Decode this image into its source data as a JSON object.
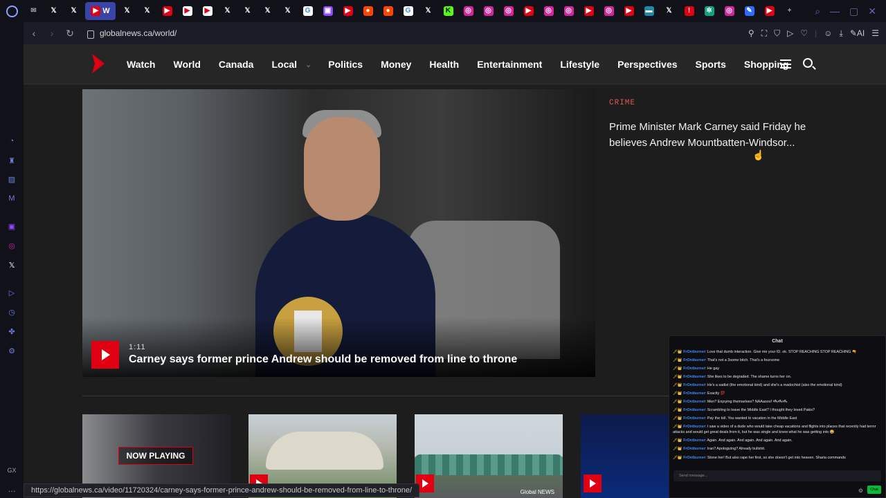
{
  "browser": {
    "tabs": [
      {
        "name": "tab-mail-icon",
        "glyph": "✉",
        "color": "#9aa0b4",
        "bg": "transparent"
      },
      {
        "name": "tab-x-icon",
        "glyph": "𝕏",
        "color": "#ffffff",
        "bg": "transparent"
      },
      {
        "name": "tab-x-icon",
        "glyph": "𝕏",
        "color": "#ffffff",
        "bg": "transparent"
      },
      {
        "name": "tab-active-world",
        "glyph": "▶",
        "color": "#ffffff",
        "bg": "#e10012"
      },
      {
        "name": "tab-x-icon",
        "glyph": "𝕏",
        "color": "#ffffff",
        "bg": "transparent"
      },
      {
        "name": "tab-x-icon",
        "glyph": "𝕏",
        "color": "#ffffff",
        "bg": "transparent"
      },
      {
        "name": "tab-youtube-icon",
        "glyph": "▶",
        "color": "#ffffff",
        "bg": "#e10012"
      },
      {
        "name": "tab-globalnews-icon",
        "glyph": "▶",
        "color": "#e10012",
        "bg": "#ffffff"
      },
      {
        "name": "tab-globalnews-icon",
        "glyph": "▶",
        "color": "#e10012",
        "bg": "#ffffff"
      },
      {
        "name": "tab-x-icon",
        "glyph": "𝕏",
        "color": "#ffffff",
        "bg": "transparent"
      },
      {
        "name": "tab-x-icon",
        "glyph": "𝕏",
        "color": "#ffffff",
        "bg": "transparent"
      },
      {
        "name": "tab-x-icon",
        "glyph": "𝕏",
        "color": "#ffffff",
        "bg": "transparent"
      },
      {
        "name": "tab-x-icon",
        "glyph": "𝕏",
        "color": "#ffffff",
        "bg": "transparent"
      },
      {
        "name": "tab-google-icon",
        "glyph": "G",
        "color": "#4285f4",
        "bg": "#ffffff"
      },
      {
        "name": "tab-twitch-icon",
        "glyph": "▣",
        "color": "#ffffff",
        "bg": "#9146ff"
      },
      {
        "name": "tab-youtube-icon",
        "glyph": "▶",
        "color": "#ffffff",
        "bg": "#e10012"
      },
      {
        "name": "tab-reddit-icon",
        "glyph": "●",
        "color": "#ffffff",
        "bg": "#ff4500"
      },
      {
        "name": "tab-reddit-icon",
        "glyph": "●",
        "color": "#ffffff",
        "bg": "#ff4500"
      },
      {
        "name": "tab-google-icon",
        "glyph": "G",
        "color": "#4285f4",
        "bg": "#ffffff"
      },
      {
        "name": "tab-x-icon",
        "glyph": "𝕏",
        "color": "#ffffff",
        "bg": "transparent"
      },
      {
        "name": "tab-kick-icon",
        "glyph": "K",
        "color": "#000000",
        "bg": "#53fc18"
      },
      {
        "name": "tab-instagram-icon",
        "glyph": "◎",
        "color": "#ffffff",
        "bg": "#d6249f"
      },
      {
        "name": "tab-instagram-icon",
        "glyph": "◎",
        "color": "#ffffff",
        "bg": "#d6249f"
      },
      {
        "name": "tab-instagram-icon",
        "glyph": "◎",
        "color": "#ffffff",
        "bg": "#d6249f"
      },
      {
        "name": "tab-youtube-icon",
        "glyph": "▶",
        "color": "#ffffff",
        "bg": "#e10012"
      },
      {
        "name": "tab-instagram-icon",
        "glyph": "◎",
        "color": "#ffffff",
        "bg": "#d6249f"
      },
      {
        "name": "tab-instagram-icon",
        "glyph": "◎",
        "color": "#ffffff",
        "bg": "#d6249f"
      },
      {
        "name": "tab-youtube-icon",
        "glyph": "▶",
        "color": "#ffffff",
        "bg": "#e10012"
      },
      {
        "name": "tab-instagram-icon",
        "glyph": "◎",
        "color": "#ffffff",
        "bg": "#d6249f"
      },
      {
        "name": "tab-youtube-icon",
        "glyph": "▶",
        "color": "#ffffff",
        "bg": "#e10012"
      },
      {
        "name": "tab-news-icon",
        "glyph": "▬",
        "color": "#ffffff",
        "bg": "#1e88a8"
      },
      {
        "name": "tab-x-icon",
        "glyph": "𝕏",
        "color": "#ffffff",
        "bg": "transparent"
      },
      {
        "name": "tab-alert-icon",
        "glyph": "!",
        "color": "#ffffff",
        "bg": "#e10012"
      },
      {
        "name": "tab-chatgpt-icon",
        "glyph": "✲",
        "color": "#ffffff",
        "bg": "#10a37f"
      },
      {
        "name": "tab-instagram-icon",
        "glyph": "◎",
        "color": "#ffffff",
        "bg": "#d6249f"
      },
      {
        "name": "tab-edit-icon",
        "glyph": "✎",
        "color": "#ffffff",
        "bg": "#2b6cff"
      },
      {
        "name": "tab-youtube-icon",
        "glyph": "▶",
        "color": "#ffffff",
        "bg": "#e10012"
      },
      {
        "name": "new-tab-icon",
        "glyph": "+",
        "color": "#9aa0b4",
        "bg": "transparent"
      }
    ],
    "active_tab_label": "W",
    "url": "globalnews.ca/world/",
    "ai_label": "AI",
    "status_url": "https://globalnews.ca/video/11720324/carney-says-former-prince-andrew-should-be-removed-from-line-to-throne/",
    "sidebar_bottom_label": "GX"
  },
  "site": {
    "nav": [
      {
        "label": "Watch"
      },
      {
        "label": "World"
      },
      {
        "label": "Canada"
      },
      {
        "label": "Local"
      },
      {
        "label": "Politics"
      },
      {
        "label": "Money"
      },
      {
        "label": "Health"
      },
      {
        "label": "Entertainment"
      },
      {
        "label": "Lifestyle"
      },
      {
        "label": "Perspectives"
      },
      {
        "label": "Sports"
      },
      {
        "label": "Shopping"
      }
    ],
    "hero": {
      "duration": "1:11",
      "title": "Carney says former prince Andrew should be removed from line to throne"
    },
    "side_story": {
      "kicker": "CRIME",
      "headline": "Prime Minister Mark Carney said Friday he believes Andrew Mountbatten-Windsor..."
    },
    "thumbs": {
      "now_playing": "NOW PLAYING",
      "logo_text": "Global NEWS"
    }
  },
  "chat": {
    "title": "Chat",
    "messages": [
      {
        "user": "FrOntburner",
        "text": "Love that dumb interaction. Give me your ID. ok. STOP REACHING STOP REACHING 🔫"
      },
      {
        "user": "FrOntburner",
        "text": "That's not a 3some bitch. That's a foursome"
      },
      {
        "user": "FrOntburner",
        "text": "He gay"
      },
      {
        "user": "FrOntburner",
        "text": "She likes to be degraded. The shame turns her on."
      },
      {
        "user": "FrOntburner",
        "text": "He's a sadist (the emotional kind) and she's a madochist (also the emotional kind)"
      },
      {
        "user": "FrOntburner",
        "text": "Exactly 💯"
      },
      {
        "user": "FrOntburner",
        "text": "Men? Enjoying themselves? NAAaooo! 🛥🛥🛥"
      },
      {
        "user": "FrOntburner",
        "text": "Scrambling to leave the Middle East? I thought they loved Pakis?"
      },
      {
        "user": "FrOntburner",
        "text": "Pay the toll. You wanted to vacation in the Middle East"
      },
      {
        "user": "FrOntburner",
        "text": "I saw a video of a dude who would take cheap vacations and flights into places that recently had terror attacks and would get great deals from it, but he was single and knew what he was getting into 😂",
        "wrap": true
      },
      {
        "user": "FrOntburner",
        "text": "Again. And again. And again. And again. And again."
      },
      {
        "user": "FrOntburner",
        "text": "Iran? Apologizing? Already bullshit."
      },
      {
        "user": "FrOntburner",
        "text": "Stone her! But also rape her first, so she doesn't get into heaven. Sharia commands"
      }
    ],
    "badges": "🗡👑",
    "input_placeholder": "Send message...",
    "send_label": "Chat"
  }
}
